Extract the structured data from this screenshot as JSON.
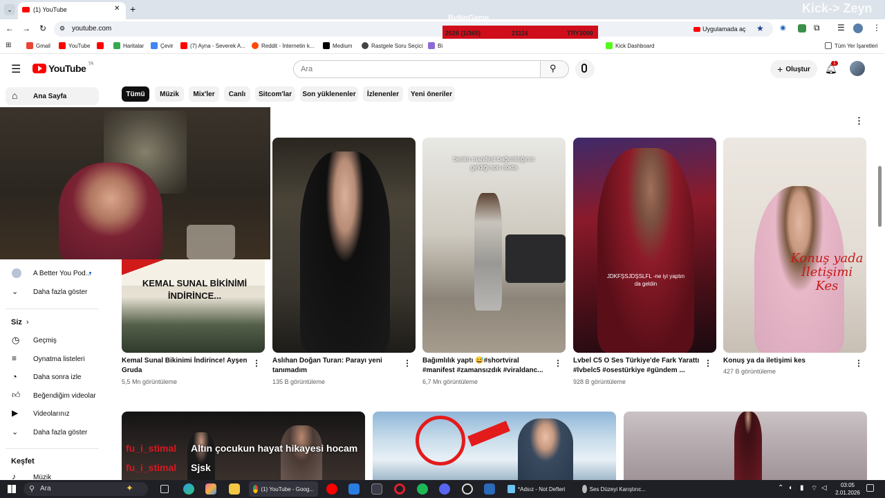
{
  "browser": {
    "tab_title": "(1) YouTube",
    "url": "youtube.com",
    "open_in_app": "Uygulamada aç",
    "bookmarks": [
      "Gmail",
      "YouTube",
      "",
      "Haritalar",
      "Çevir",
      "(7) Ayna - Severek A...",
      "Reddit - İnternetin k...",
      "Medium",
      "Rastgele Soru Seçici",
      "Bi",
      "Kick Dashboard"
    ],
    "all_bookmarks": "Tüm Yer İşaretleri"
  },
  "overlay": {
    "watermark": "ByNoGame",
    "year_progress": "2026 (1/365)",
    "count": "21116",
    "currency": "TRY3000",
    "streamer_banner": "Kick-> Zeyn"
  },
  "youtube": {
    "logo_text": "YouTube",
    "logo_country": "TR",
    "search_placeholder": "Ara",
    "create_label": "Oluştur",
    "notification_count": "1",
    "chips": [
      "Tümü",
      "Müzik",
      "Mix'ler",
      "Canlı",
      "Sitcom'lar",
      "Son yüklenenler",
      "İzlenenler",
      "Yeni öneriler"
    ],
    "sidebar": {
      "home": "Ana Sayfa",
      "subscription_item": "A Better You Pod...",
      "show_more_1": "Daha fazla göster",
      "you_heading": "Siz",
      "you_items": [
        "Geçmiş",
        "Oynatma listeleri",
        "Daha sonra izle",
        "Beğendiğim videolar",
        "Videolarınız",
        "Daha fazla göster"
      ],
      "explore_heading": "Keşfet",
      "explore_items": [
        "Müzik"
      ]
    },
    "videos": [
      {
        "title": "Kemal Sunal Bikinimi İndirince! Ayşen Gruda",
        "meta": "5,5 Mn görüntüleme",
        "thumb_text": "KEMAL SUNAL BİKİNİMİ İNDİRİNCE..."
      },
      {
        "title": "Aslıhan Doğan Turan: Parayı yeni tanımadım",
        "meta": "135 B görüntüleme"
      },
      {
        "title": "Bağımlılık yaptı 😅#shortviral #manifest #zamansızdık #viraldanc...",
        "meta": "6,7 Mn görüntüleme",
        "thumb_text": "benim manifest bağımlılığının geldiği son nokta"
      },
      {
        "title": "Lvbel C5 O Ses Türkiye'de Fark Yarattı #lvbelc5 #osestürkiye #gündem ...",
        "meta": "928 B görüntüleme",
        "thumb_text": "JDKFŞSJDŞSLFL -ne iyi yaptın da geldin"
      },
      {
        "title": "Konuş ya da iletişimi kes",
        "meta": "427 B görüntüleme",
        "thumb_text": "Konuş yada İletişimi Kes"
      }
    ],
    "row2_overlays": [
      "fu_i_stimal",
      "Altın çocukun hayat hikayesi hocam",
      "fu_i_stimal",
      "Sjsk"
    ]
  },
  "taskbar": {
    "search_label": "Ara",
    "tasks": [
      "(1) YouTube - Goog...",
      "*Adsız - Not Defteri",
      "Ses Düzeyi Karıştırıc..."
    ],
    "time": "03:05",
    "date": "2.01.2026"
  },
  "colors": {
    "youtube_red": "#ff0000",
    "overlay_red": "#d00d1a",
    "chip_active": "#0f0f0f"
  }
}
